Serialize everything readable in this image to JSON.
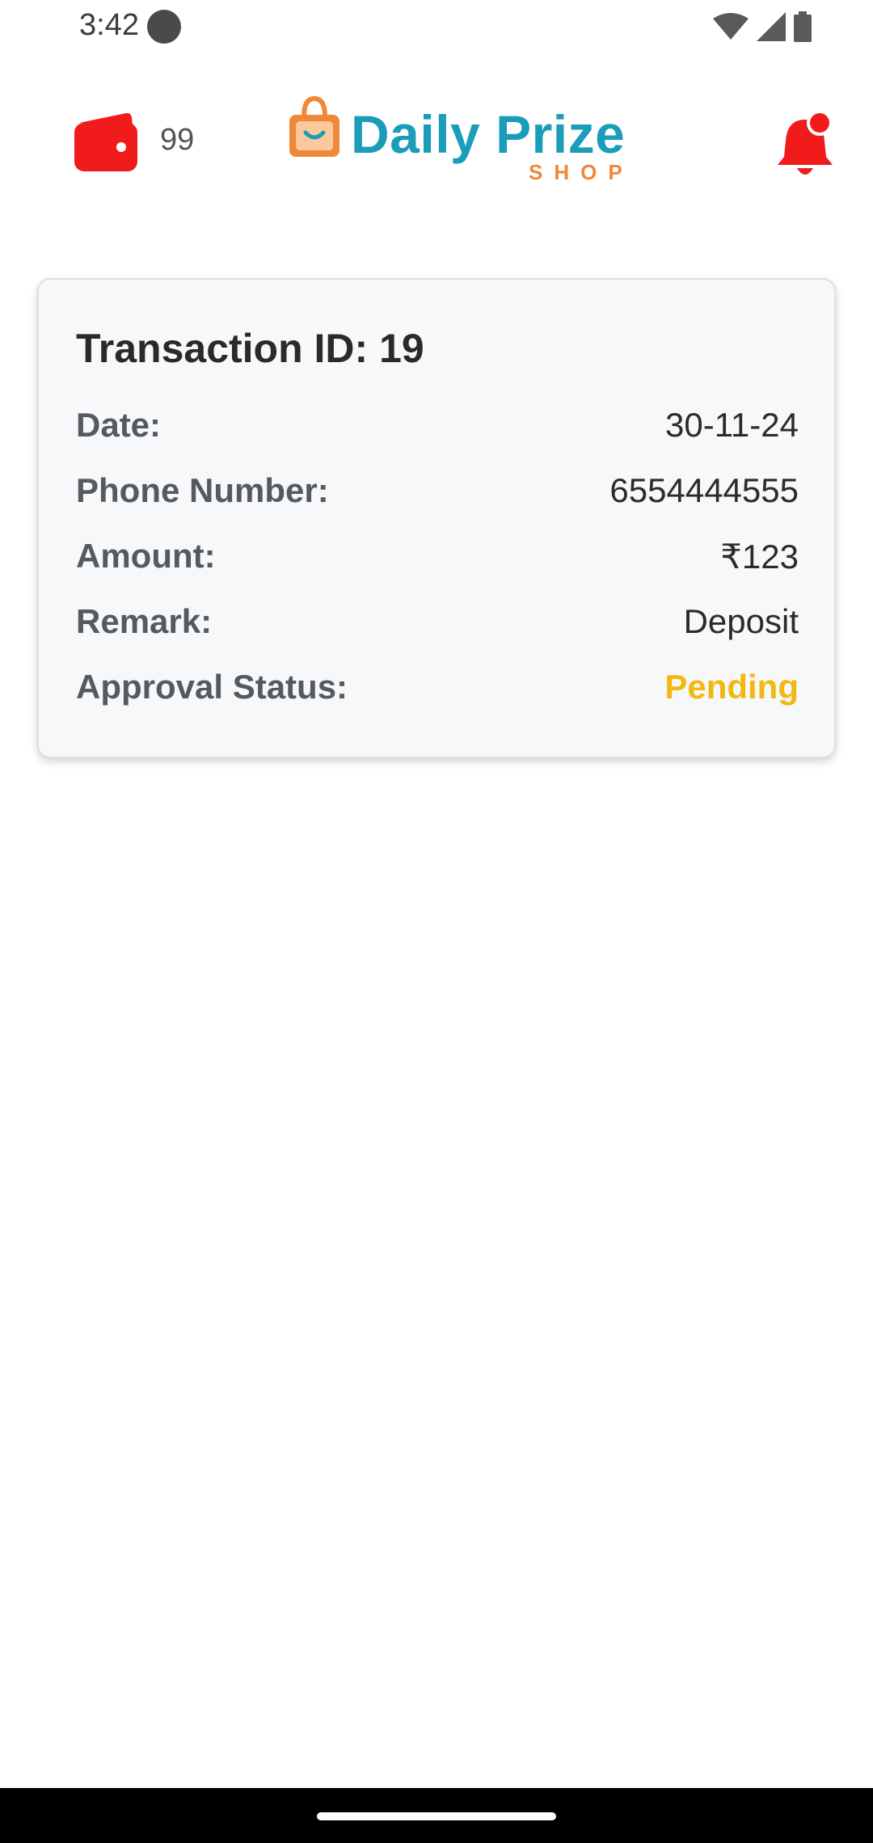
{
  "status_bar": {
    "time": "3:42"
  },
  "header": {
    "wallet_count": "99",
    "logo_title": "Daily Prize",
    "logo_subtitle": "SHOP"
  },
  "transaction": {
    "title": "Transaction ID: 19",
    "rows": [
      {
        "label": "Date:",
        "value": "30-11-24"
      },
      {
        "label": "Phone Number:",
        "value": "6554444555"
      },
      {
        "label": "Amount:",
        "value": "₹123"
      },
      {
        "label": "Remark:",
        "value": "Deposit"
      },
      {
        "label": "Approval Status:",
        "value": "Pending"
      }
    ]
  },
  "colors": {
    "accent_red": "#f21b1b",
    "brand_teal": "#1b9cb8",
    "brand_orange": "#f0883a",
    "pending": "#f2b810"
  }
}
